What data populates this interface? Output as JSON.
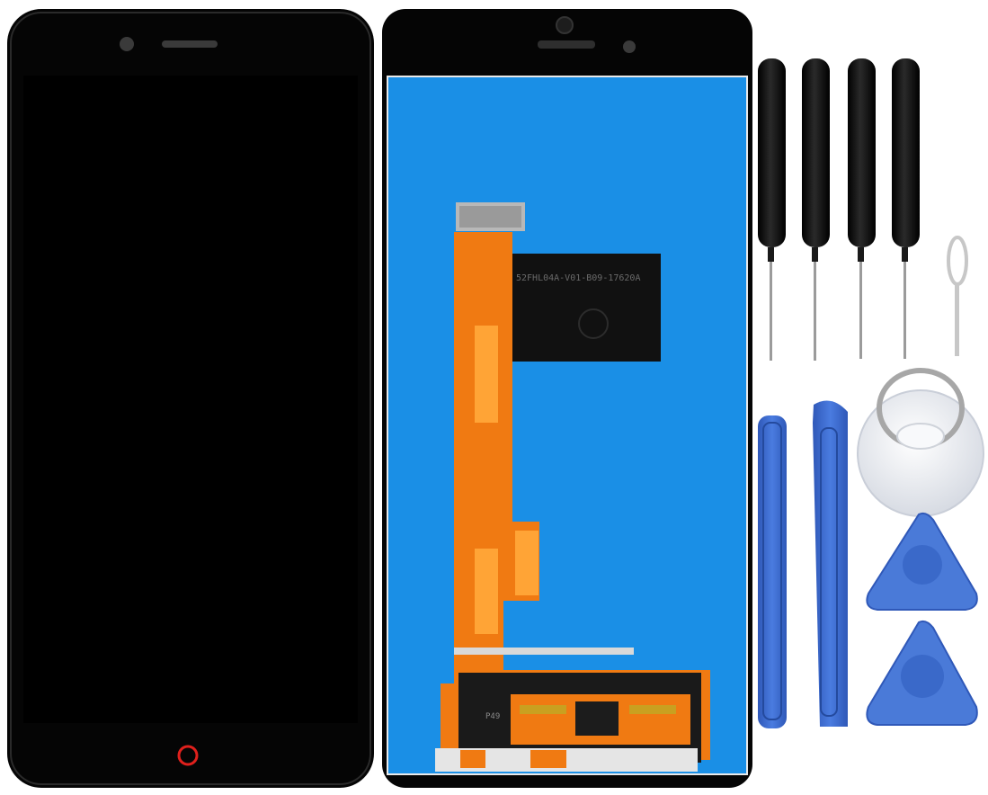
{
  "image": {
    "colors": {
      "background": "#ffffff",
      "phone_black": "#050505",
      "lcd_blue": "#1a8fe6",
      "flex_orange": "#f07a12",
      "tool_black": "#0d0d0d",
      "pry_blue": "#3f6fd1",
      "suction_clear": "#eef0f4",
      "home_ring_red": "#e0201c"
    },
    "objects": [
      {
        "name": "lcd-front",
        "icon": "phone-front"
      },
      {
        "name": "lcd-back",
        "icon": "phone-back-panel"
      },
      {
        "name": "screwdrivers",
        "count": 4
      },
      {
        "name": "sim-eject-pin"
      },
      {
        "name": "pry-spudgers",
        "count": 2
      },
      {
        "name": "suction-cup"
      },
      {
        "name": "triangle-picks",
        "count": 2
      }
    ],
    "flex_label": "52FHL04A-V01-B09-17620A",
    "chip_label": "P49"
  }
}
